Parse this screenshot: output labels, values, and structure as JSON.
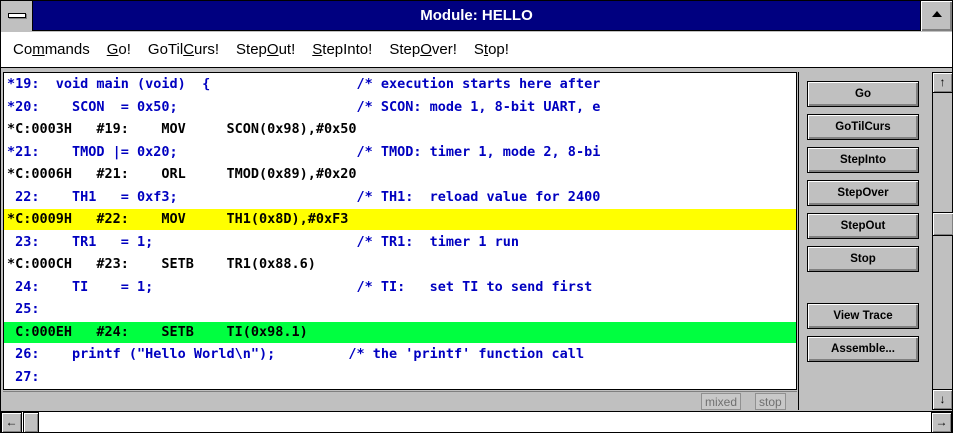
{
  "window": {
    "title": "Module: HELLO"
  },
  "menu": [
    {
      "pre": "Co",
      "u": "m",
      "post": "mands"
    },
    {
      "pre": "",
      "u": "G",
      "post": "o!"
    },
    {
      "pre": "GoTil",
      "u": "C",
      "post": "urs!"
    },
    {
      "pre": "Step",
      "u": "O",
      "post": "ut!"
    },
    {
      "pre": "",
      "u": "S",
      "post": "tepInto!"
    },
    {
      "pre": "Step",
      "u": "O",
      "post": "ver!"
    },
    {
      "pre": "S",
      "u": "t",
      "post": "op!"
    }
  ],
  "code_lines": [
    {
      "text": "*19:  void main (void)  {                  /* execution starts here after",
      "kind": "src",
      "hl": ""
    },
    {
      "text": "*20:    SCON  = 0x50;                      /* SCON: mode 1, 8-bit UART, e",
      "kind": "src",
      "hl": ""
    },
    {
      "text": "*C:0003H   #19:    MOV     SCON(0x98),#0x50",
      "kind": "asm",
      "hl": ""
    },
    {
      "text": "*21:    TMOD |= 0x20;                      /* TMOD: timer 1, mode 2, 8-bi",
      "kind": "src",
      "hl": ""
    },
    {
      "text": "*C:0006H   #21:    ORL     TMOD(0x89),#0x20",
      "kind": "asm",
      "hl": ""
    },
    {
      "text": " 22:    TH1   = 0xf3;                      /* TH1:  reload value for 2400",
      "kind": "src",
      "hl": ""
    },
    {
      "text": "*C:0009H   #22:    MOV     TH1(0x8D),#0xF3",
      "kind": "asm",
      "hl": "yellow"
    },
    {
      "text": " 23:    TR1   = 1;                         /* TR1:  timer 1 run",
      "kind": "src",
      "hl": ""
    },
    {
      "text": "*C:000CH   #23:    SETB    TR1(0x88.6)",
      "kind": "asm",
      "hl": ""
    },
    {
      "text": " 24:    TI    = 1;                         /* TI:   set TI to send first",
      "kind": "src",
      "hl": ""
    },
    {
      "text": " 25:",
      "kind": "src",
      "hl": ""
    },
    {
      "text": " C:000EH   #24:    SETB    TI(0x98.1)",
      "kind": "asm",
      "hl": "green"
    },
    {
      "text": " 26:    printf (\"Hello World\\n\");         /* the 'printf' function call",
      "kind": "src",
      "hl": ""
    },
    {
      "text": " 27:",
      "kind": "src",
      "hl": ""
    }
  ],
  "status": {
    "mode": "mixed",
    "state": "stop"
  },
  "buttons": {
    "go": "Go",
    "gotilcurs": "GoTilCurs",
    "stepinto": "StepInto",
    "stepover": "StepOver",
    "stepout": "StepOut",
    "stop": "Stop",
    "viewtrace": "View Trace",
    "assemble": "Assemble..."
  },
  "icons": {
    "scroll_up": "↑",
    "scroll_down": "↓",
    "scroll_left": "←",
    "scroll_right": "→"
  },
  "colors": {
    "titlebar": "#000080",
    "source_text": "#0000c0",
    "current_line": "#00ff40",
    "breakpoint_line": "#ffff00"
  }
}
